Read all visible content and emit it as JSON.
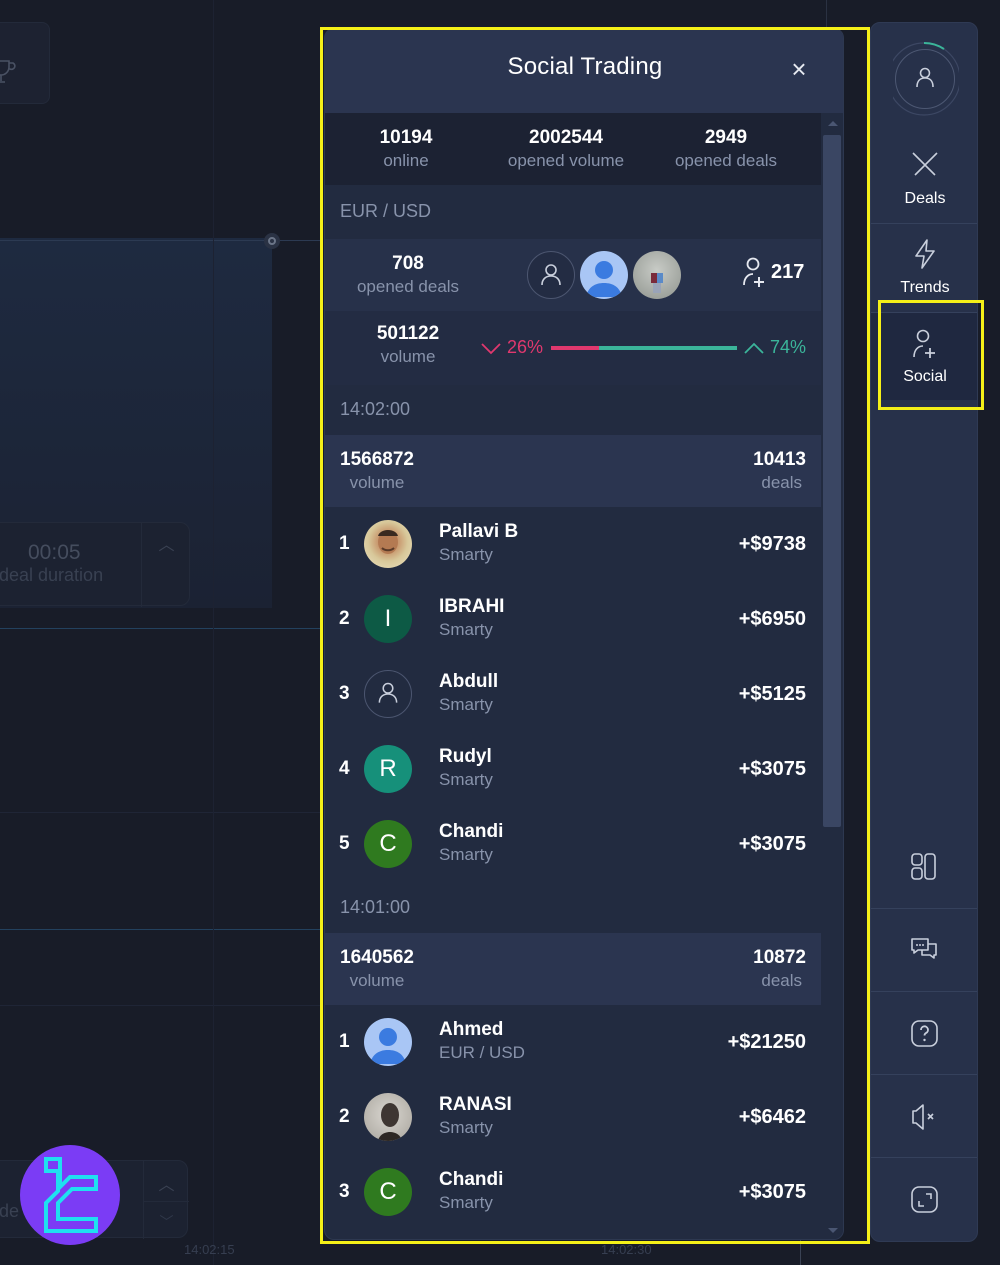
{
  "panel": {
    "title": "Social Trading",
    "close_label": "×"
  },
  "stats": [
    {
      "value": "10194",
      "label": "online"
    },
    {
      "value": "2002544",
      "label": "opened volume"
    },
    {
      "value": "2949",
      "label": "opened deals"
    }
  ],
  "asset": {
    "pair": "EUR / USD",
    "opened_deals_value": "708",
    "opened_deals_label": "opened deals",
    "followers_count": "217",
    "volume_value": "501122",
    "volume_label": "volume",
    "sentiment": {
      "down_percent": 26,
      "up_percent": 74,
      "down_label": "26%",
      "up_label": "74%",
      "down_color": "#e0386e",
      "up_color": "#3bb59a"
    }
  },
  "periods": [
    {
      "time": "14:02:00",
      "volume_value": "1566872",
      "volume_label": "volume",
      "deals_value": "10413",
      "deals_label": "deals",
      "traders": [
        {
          "rank": "1",
          "name": "Pallavi B",
          "sub": "Smarty",
          "profit": "+$9738",
          "avatar": "photo",
          "initial": ""
        },
        {
          "rank": "2",
          "name": "IBRAHI",
          "sub": "Smarty",
          "profit": "+$6950",
          "avatar": "initial",
          "initial": "I",
          "color": "#0d5a45"
        },
        {
          "rank": "3",
          "name": "Abdull",
          "sub": "Smarty",
          "profit": "+$5125",
          "avatar": "outline",
          "initial": ""
        },
        {
          "rank": "4",
          "name": "Rudyl",
          "sub": "Smarty",
          "profit": "+$3075",
          "avatar": "initial",
          "initial": "R",
          "color": "#16907a"
        },
        {
          "rank": "5",
          "name": "Chandi",
          "sub": "Smarty",
          "profit": "+$3075",
          "avatar": "initial",
          "initial": "C",
          "color": "#2f7a1f"
        }
      ]
    },
    {
      "time": "14:01:00",
      "volume_value": "1640562",
      "volume_label": "volume",
      "deals_value": "10872",
      "deals_label": "deals",
      "traders": [
        {
          "rank": "1",
          "name": "Ahmed",
          "sub": "EUR / USD",
          "profit": "+$21250",
          "avatar": "default",
          "initial": ""
        },
        {
          "rank": "2",
          "name": "RANASI",
          "sub": "Smarty",
          "profit": "+$6462",
          "avatar": "photo2",
          "initial": ""
        },
        {
          "rank": "3",
          "name": "Chandi",
          "sub": "Smarty",
          "profit": "+$3075",
          "avatar": "initial",
          "initial": "C",
          "color": "#2f7a1f"
        }
      ]
    }
  ],
  "sidebar": {
    "items": [
      {
        "label": "Deals",
        "icon": "deals-icon"
      },
      {
        "label": "Trends",
        "icon": "lightning-icon"
      },
      {
        "label": "Social",
        "icon": "user-plus-icon",
        "active": true
      }
    ],
    "tools": [
      {
        "icon": "layout-icon"
      },
      {
        "icon": "chat-icon"
      },
      {
        "icon": "help-icon"
      },
      {
        "icon": "mute-icon"
      },
      {
        "icon": "fullscreen-icon"
      }
    ]
  },
  "background": {
    "duration_value": "00:05",
    "duration_label": "deal duration",
    "invest_label": "de",
    "time_ticks": [
      "14:02:15",
      "14:02:30"
    ]
  }
}
